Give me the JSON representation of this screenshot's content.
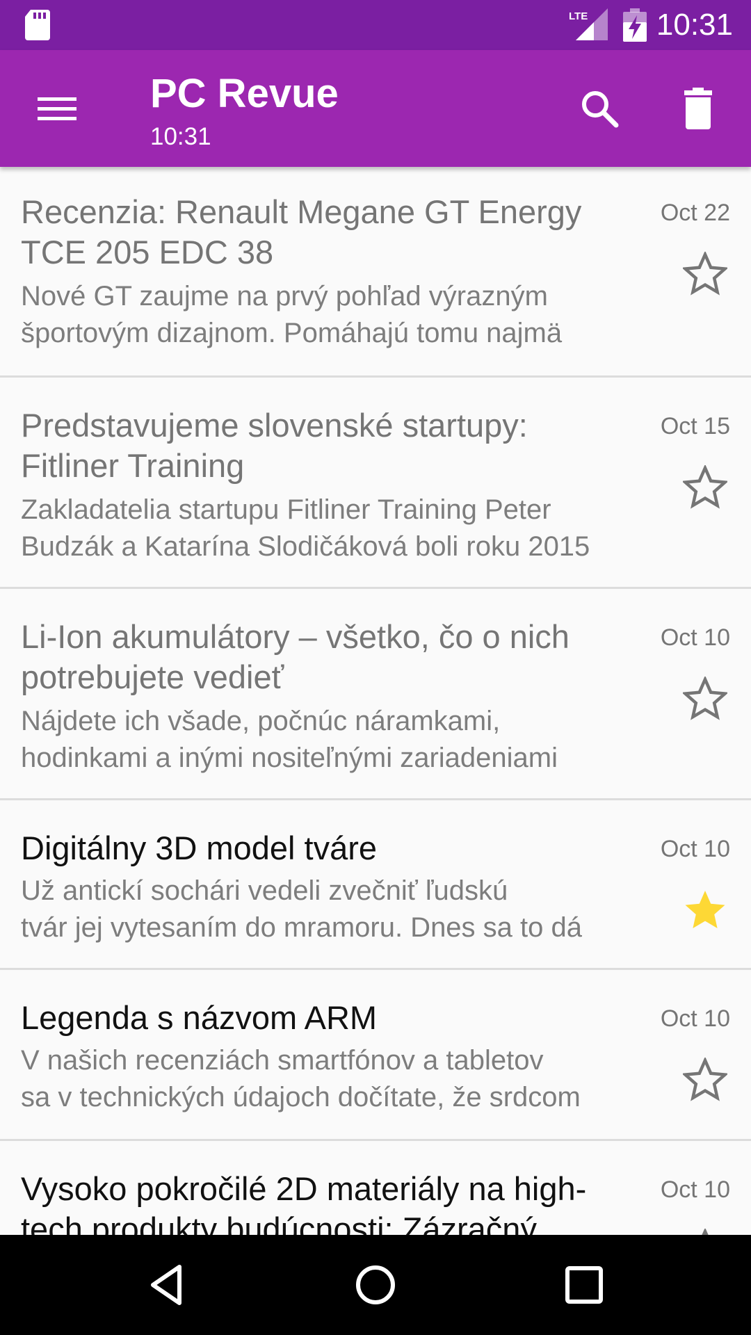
{
  "status_bar": {
    "time": "10:31",
    "network_label": "LTE",
    "icons": [
      "sd-card-icon",
      "lte-signal-icon",
      "battery-charging-icon"
    ]
  },
  "app_bar": {
    "title": "PC Revue",
    "subtitle": "10:31",
    "icons": [
      "menu-icon",
      "search-icon",
      "delete-icon"
    ],
    "color": "#9c27b0"
  },
  "articles": [
    {
      "title_lines": [
        "Recenzia: Renault Megane GT Energy",
        "TCE 205 EDC 38"
      ],
      "snippet_lines": [
        "Nové GT zaujme na prvý pohľad výrazným",
        "športovým dizajnom. Pomáhajú tomu najmä"
      ],
      "date": "Oct 22",
      "starred": false,
      "read": true
    },
    {
      "title_lines": [
        "Predstavujeme slovenské startupy:",
        "Fitliner Training"
      ],
      "snippet_lines": [
        "Zakladatelia startupu Fitliner Training Peter",
        "Budzák a Katarína Slodičáková boli roku 2015"
      ],
      "date": "Oct 15",
      "starred": false,
      "read": true
    },
    {
      "title_lines": [
        "Li-Ion akumulátory – všetko, čo o nich",
        "potrebujete vedieť"
      ],
      "snippet_lines": [
        "Nájdete ich všade, počnúc náramkami,",
        "hodinkami a inými nositeľnými zariadeniami"
      ],
      "date": "Oct 10",
      "starred": false,
      "read": true
    },
    {
      "title_lines": [
        "Digitálny 3D model tváre"
      ],
      "snippet_lines": [
        "Už antickí sochári vedeli zvečniť ľudskú",
        "tvár jej vytesaním do mramoru. Dnes sa to dá"
      ],
      "date": "Oct 10",
      "starred": true,
      "read": false
    },
    {
      "title_lines": [
        "Legenda s názvom ARM"
      ],
      "snippet_lines": [
        "V našich recenziách smartfónov a tabletov",
        "sa v technických údajoch dočítate, že srdcom"
      ],
      "date": "Oct 10",
      "starred": false,
      "read": false
    },
    {
      "title_lines": [
        "Vysoko pokročilé 2D materiály na high-",
        "tech produkty budúcnosti: Zázračný"
      ],
      "snippet_lines": [],
      "date": "Oct 10",
      "starred": false,
      "read": false
    }
  ],
  "colors": {
    "status_bar": "#7b1fa2",
    "app_bar": "#9c27b0",
    "star_active": "#fdd835",
    "star_inactive": "#757575"
  },
  "nav_bar": {
    "icons": [
      "back-icon",
      "home-icon",
      "recents-icon"
    ]
  }
}
